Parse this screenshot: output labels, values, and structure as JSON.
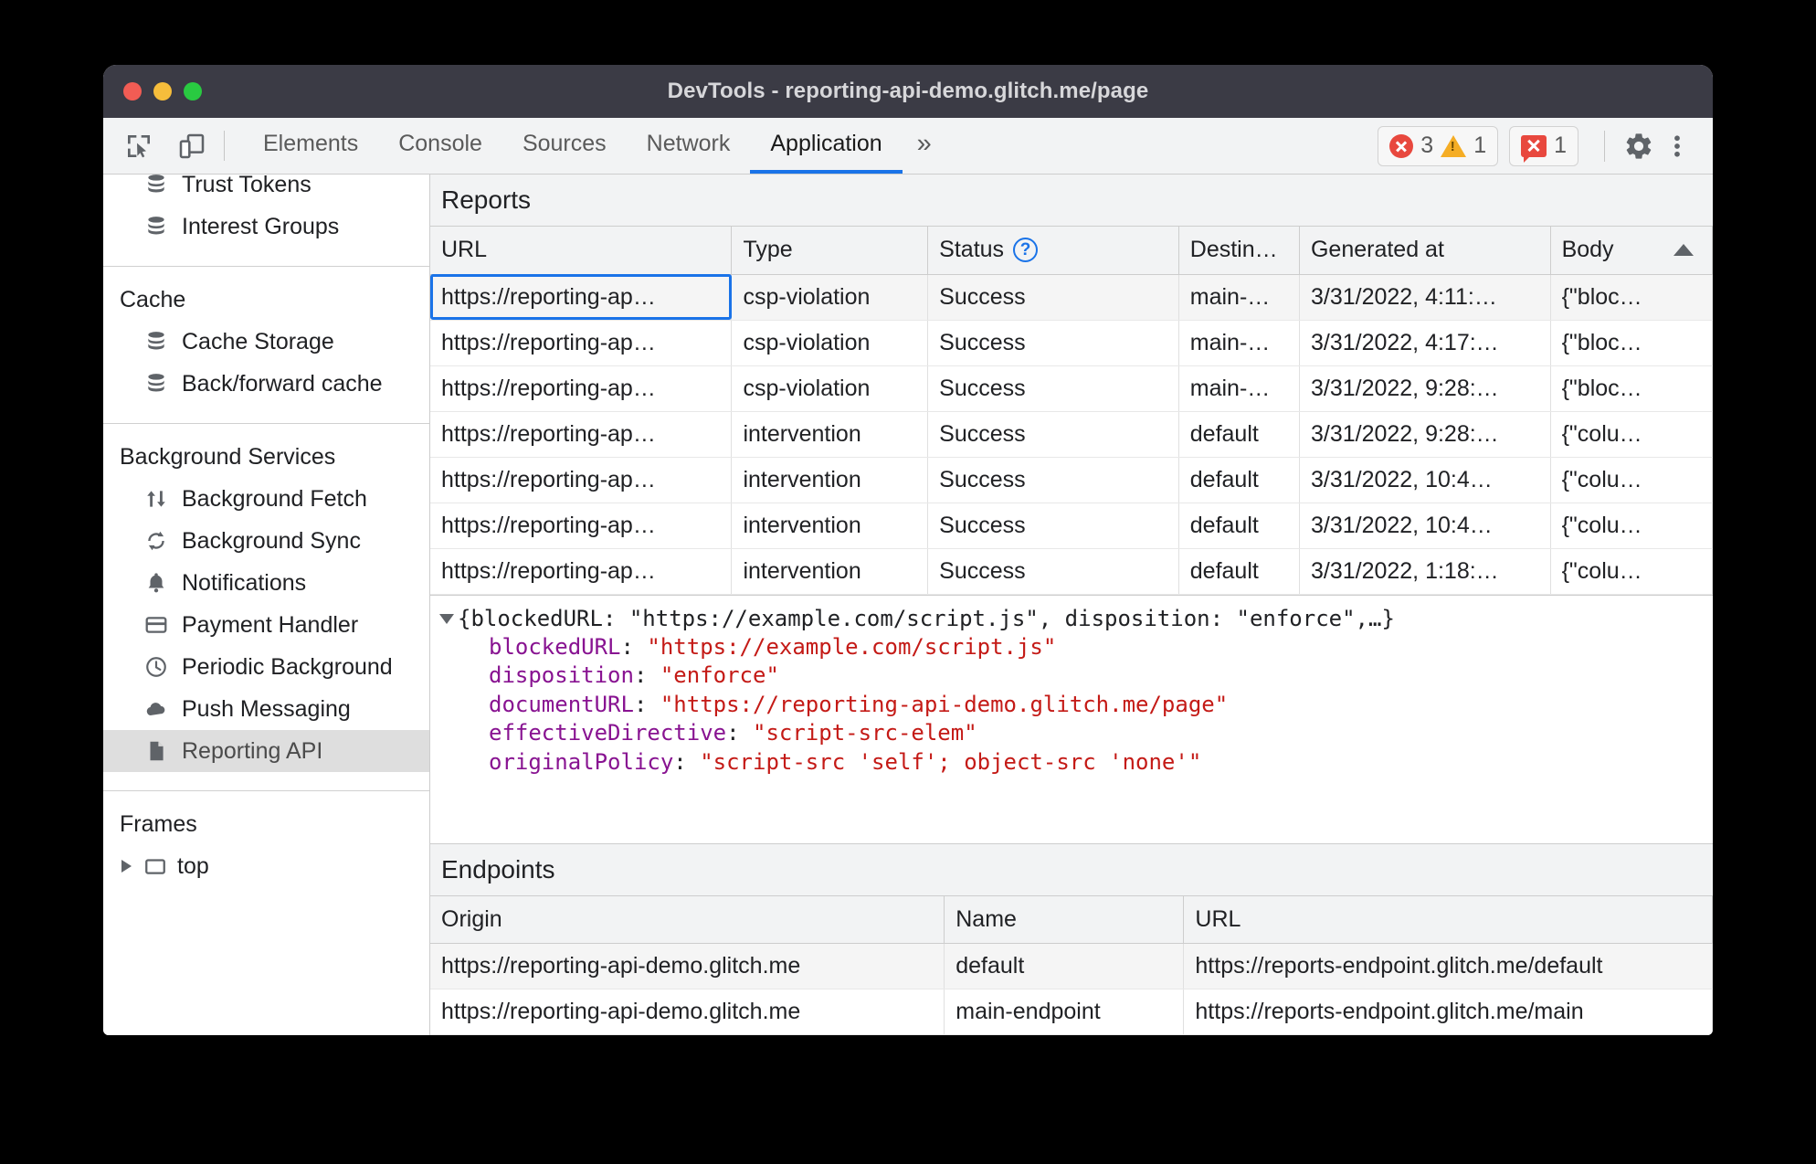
{
  "window": {
    "title": "DevTools - reporting-api-demo.glitch.me/page",
    "traffic_lights": [
      "close",
      "minimize",
      "maximize"
    ]
  },
  "toolbar": {
    "inspect_icon": "inspect-cursor-icon",
    "device_icon": "device-toolbar-icon",
    "tabs": [
      {
        "label": "Elements",
        "active": false
      },
      {
        "label": "Console",
        "active": false
      },
      {
        "label": "Sources",
        "active": false
      },
      {
        "label": "Network",
        "active": false
      },
      {
        "label": "Application",
        "active": true
      }
    ],
    "more_tabs_label": "»",
    "errors_count": "3",
    "warnings_count": "1",
    "issues_count": "1",
    "settings_icon": "gear-icon",
    "more_icon": "kebab-menu-icon",
    "accent_color": "#1a73e8",
    "error_color": "#e8483e",
    "warning_color": "#f5ad25"
  },
  "sidebar": {
    "top_items": [
      {
        "label": "Trust Tokens",
        "icon": "database-icon"
      },
      {
        "label": "Interest Groups",
        "icon": "database-icon"
      }
    ],
    "cache_group": {
      "title": "Cache",
      "items": [
        {
          "label": "Cache Storage",
          "icon": "database-icon"
        },
        {
          "label": "Back/forward cache",
          "icon": "database-icon"
        }
      ]
    },
    "background_group": {
      "title": "Background Services",
      "items": [
        {
          "label": "Background Fetch",
          "icon": "arrows-up-down-icon"
        },
        {
          "label": "Background Sync",
          "icon": "sync-icon"
        },
        {
          "label": "Notifications",
          "icon": "bell-icon"
        },
        {
          "label": "Payment Handler",
          "icon": "credit-card-icon"
        },
        {
          "label": "Periodic Background",
          "icon": "clock-icon"
        },
        {
          "label": "Push Messaging",
          "icon": "cloud-icon"
        },
        {
          "label": "Reporting API",
          "icon": "document-icon",
          "selected": true
        }
      ]
    },
    "frames_group": {
      "title": "Frames",
      "items": [
        {
          "label": "top",
          "icon": "frame-icon",
          "expander": "chevron-right-icon"
        }
      ]
    }
  },
  "reports": {
    "title": "Reports",
    "columns": [
      "URL",
      "Type",
      "Status",
      "Destin…",
      "Generated at",
      "Body"
    ],
    "status_help_icon": "help-icon",
    "sorted_column": "Body",
    "sort_direction": "ascending",
    "rows": [
      {
        "url": "https://reporting-ap…",
        "type": "csp-violation",
        "status": "Success",
        "destination": "main-…",
        "generated_at": "3/31/2022, 4:11:…",
        "body": "{\"bloc…",
        "selected": true
      },
      {
        "url": "https://reporting-ap…",
        "type": "csp-violation",
        "status": "Success",
        "destination": "main-…",
        "generated_at": "3/31/2022, 4:17:…",
        "body": "{\"bloc…",
        "selected": false
      },
      {
        "url": "https://reporting-ap…",
        "type": "csp-violation",
        "status": "Success",
        "destination": "main-…",
        "generated_at": "3/31/2022, 9:28:…",
        "body": "{\"bloc…",
        "selected": false
      },
      {
        "url": "https://reporting-ap…",
        "type": "intervention",
        "status": "Success",
        "destination": "default",
        "generated_at": "3/31/2022, 9:28:…",
        "body": "{\"colu…",
        "selected": false
      },
      {
        "url": "https://reporting-ap…",
        "type": "intervention",
        "status": "Success",
        "destination": "default",
        "generated_at": "3/31/2022, 10:4…",
        "body": "{\"colu…",
        "selected": false
      },
      {
        "url": "https://reporting-ap…",
        "type": "intervention",
        "status": "Success",
        "destination": "default",
        "generated_at": "3/31/2022, 10:4…",
        "body": "{\"colu…",
        "selected": false
      },
      {
        "url": "https://reporting-ap…",
        "type": "intervention",
        "status": "Success",
        "destination": "default",
        "generated_at": "3/31/2022, 1:18:…",
        "body": "{\"colu…",
        "selected": false
      }
    ]
  },
  "json_preview": {
    "expander": "triangle-down-icon",
    "summary": "{blockedURL: \"https://example.com/script.js\", disposition: \"enforce\",…}",
    "entries": [
      {
        "key": "blockedURL",
        "value": "\"https://example.com/script.js\""
      },
      {
        "key": "disposition",
        "value": "\"enforce\""
      },
      {
        "key": "documentURL",
        "value": "\"https://reporting-api-demo.glitch.me/page\""
      },
      {
        "key": "effectiveDirective",
        "value": "\"script-src-elem\""
      }
    ],
    "clipped_entry": {
      "key": "originalPolicy",
      "value": "\"script-src 'self'; object-src 'none'\""
    },
    "key_color": "#881391",
    "string_color": "#c41a16"
  },
  "endpoints": {
    "title": "Endpoints",
    "columns": [
      "Origin",
      "Name",
      "URL"
    ],
    "rows": [
      {
        "origin": "https://reporting-api-demo.glitch.me",
        "name": "default",
        "url": "https://reports-endpoint.glitch.me/default"
      },
      {
        "origin": "https://reporting-api-demo.glitch.me",
        "name": "main-endpoint",
        "url": "https://reports-endpoint.glitch.me/main"
      }
    ]
  }
}
